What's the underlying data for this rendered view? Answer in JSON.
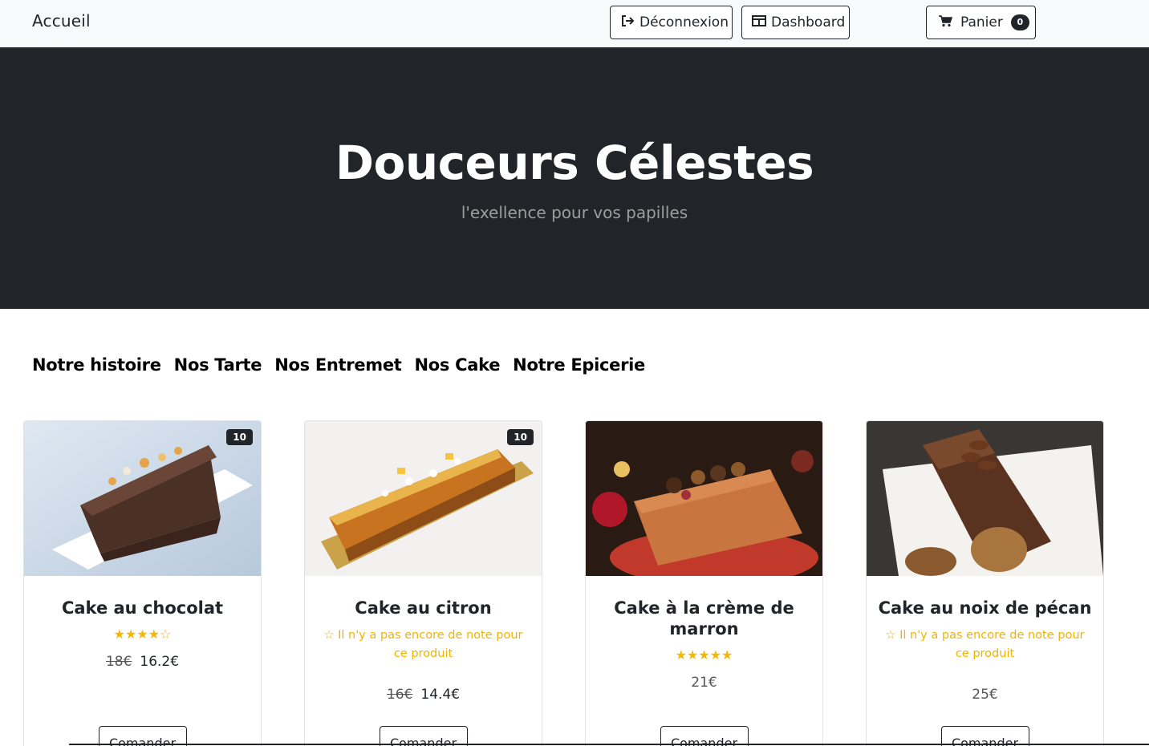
{
  "navbar": {
    "brand": "Accueil",
    "logout_label": "Déconnexion",
    "dashboard_label": "Dashboard",
    "cart_label": "Panier",
    "cart_count": "0"
  },
  "hero": {
    "title": "Douceurs Célestes",
    "subtitle": "l'exellence pour vos papilles"
  },
  "categories": [
    "Notre histoire",
    "Nos Tarte",
    "Nos Entremet",
    "Nos Cake",
    "Notre Epicerie"
  ],
  "products": [
    {
      "name": "Cake au chocolat",
      "stock": "10",
      "rating": 4,
      "rating_text": "",
      "old_price": "18€",
      "price": "16.2€"
    },
    {
      "name": "Cake au citron",
      "stock": "10",
      "rating": 0,
      "rating_text": "Il n'y a pas encore de note pour ce produit",
      "old_price": "16€",
      "price": "14.4€"
    },
    {
      "name": "Cake à la crème de marron",
      "stock": "",
      "rating": 5,
      "rating_text": "",
      "old_price": "",
      "price": "21€"
    },
    {
      "name": "Cake au noix de pécan",
      "stock": "",
      "rating": 0,
      "rating_text": "Il n'y a pas encore de note pour ce produit",
      "old_price": "",
      "price": "25€"
    }
  ],
  "order_label": "Comander",
  "icons": {
    "logout": "logout-icon",
    "dashboard": "dashboard-icon",
    "cart": "cart-icon",
    "star_full": "star-icon",
    "star_empty": "star-outline-icon"
  },
  "colors": {
    "hero_bg": "#212529",
    "star": "#f5b800",
    "navbar_bg": "#f8f9fa"
  }
}
